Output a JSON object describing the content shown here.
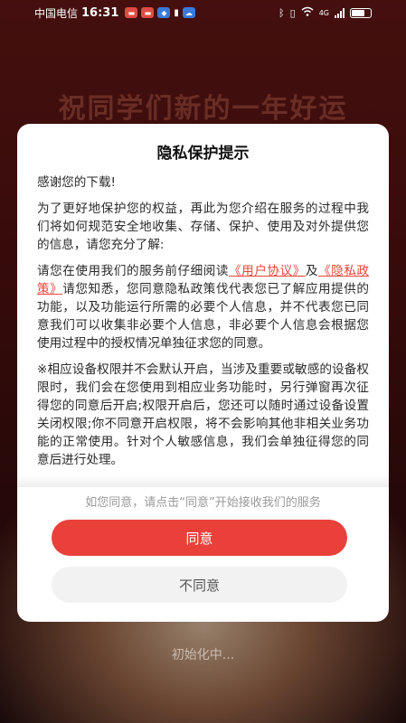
{
  "status_bar": {
    "carrier": "中国电信",
    "time": "16:31",
    "network": "4G",
    "icons": [
      "app-notification-icon",
      "app-notification-icon",
      "shield-app-icon",
      "battery-saver-icon",
      "cloud-icon",
      "bluetooth-icon",
      "vibrate-icon",
      "wifi-icon",
      "signal-icon",
      "battery-icon"
    ]
  },
  "splash": {
    "greeting": "祝同学们新的一年好运",
    "loading_text": "初始化中..."
  },
  "dialog": {
    "title": "隐私保护提示",
    "p1": "感谢您的下载!",
    "p2": "为了更好地保护您的权益，再此为您介绍在服务的过程中我们将如何规范安全地收集、存储、保护、使用及对外提供您的信息，请您充分了解:",
    "p3_a": "请您在使用我们的服务前仔细阅读",
    "user_agreement_link": "《用户协议》",
    "p3_b": "及",
    "privacy_policy_link": "《隐私政策》",
    "p3_c": "请您知悉，您同意隐私政策伐代表您已了解应用提供的功能，以及功能运行所需的必要个人信息，并不代表您已同意我们可以收集非必要个人信息，非必要个人信息会根据您使用过程中的授权情况单独征求您的同意。",
    "p4": "※相应设备权限并不会默认开启，当涉及重要或敏感的设备权限时，我们会在您使用到相应业务功能时，另行弹窗再次征得您的同意后开启;权限开启后，您还可以随时通过设备设置关闭权限;你不同意开启权限，将不会影响其他非相关业务功能的正常使用。针对个人敏感信息，我们会单独征得您的同意后进行处理。",
    "hint": "如您同意，请点击“同意”开始接收我们的服务",
    "agree_label": "同意",
    "disagree_label": "不同意"
  },
  "colors": {
    "accent": "#e9403a",
    "link": "#e8453c"
  }
}
